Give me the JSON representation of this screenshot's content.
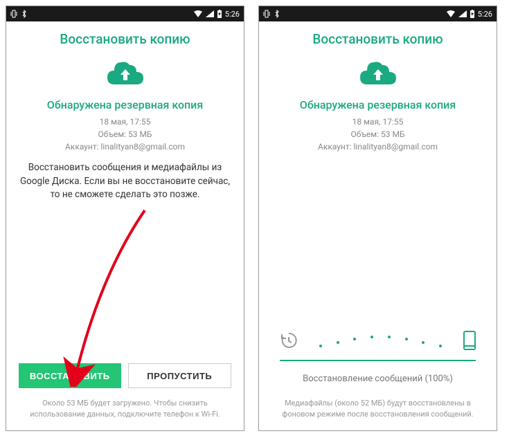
{
  "statusbar": {
    "time": "5:26"
  },
  "left": {
    "title": "Восстановить копию",
    "subtitle": "Обнаружена резервная копия",
    "meta_date": "18 мая, 17:55",
    "meta_size": "Объем: 53 МБ",
    "meta_account": "Аккаунт: linalityan8@gmail.com",
    "description": "Восстановить сообщения и медиафайлы из Google Диска. Если вы не восстановите сейчас, то не сможете сделать это позже.",
    "restore_label": "ВОССТАНОВИТЬ",
    "skip_label": "ПРОПУСТИТЬ",
    "footer": "Около 53 МБ будет загружено. Чтобы снизить использование данных, подключите телефон к Wi-Fi."
  },
  "right": {
    "title": "Восстановить копию",
    "subtitle": "Обнаружена резервная копия",
    "meta_date": "18 мая, 17:55",
    "meta_size": "Объем: 53 МБ",
    "meta_account": "Аккаунт: linalityan8@gmail.com",
    "progress_text": "Восстановление сообщений (100%)",
    "footer": "Медиафайлы (около 52 МБ) будут восстановлены в фоновом режиме после восстановления сообщений."
  }
}
